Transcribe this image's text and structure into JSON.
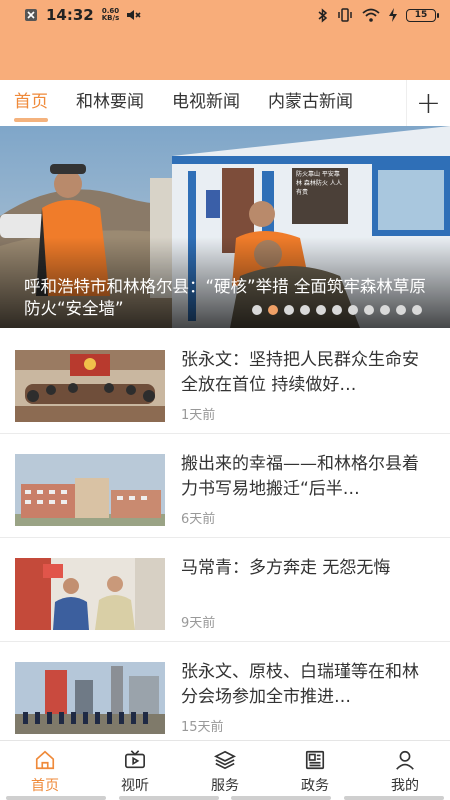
{
  "status_bar": {
    "time": "14:32",
    "net_speed_value": "0.60",
    "net_speed_unit": "KB/s",
    "battery": "15"
  },
  "tabs": [
    {
      "label": "首页",
      "active": true
    },
    {
      "label": "和林要闻",
      "active": false
    },
    {
      "label": "电视新闻",
      "active": false
    },
    {
      "label": "内蒙古新闻",
      "active": false
    }
  ],
  "add_tab_label": "+",
  "banner": {
    "caption": "呼和浩特市和林格尔县：“硬核”举措 全面筑牢森林草原防火“安全墙”",
    "sign_text": "防火靠山 平安靠林 森林防火 人人有责",
    "dot_count": 11,
    "active_dot": 1
  },
  "news": [
    {
      "title": "张永文：坚持把人民群众生命安全放在首位 持续做好…",
      "time": "1天前",
      "thumb": "meeting-room"
    },
    {
      "title": "搬出来的幸福——和林格尔县着力书写易地搬迁“后半…",
      "time": "6天前",
      "thumb": "apartment-buildings"
    },
    {
      "title": "马常青：多方奔走 无怨无悔",
      "time": "9天前",
      "thumb": "elderly-couple"
    },
    {
      "title": "张永文、原枝、白瑞瑾等在和林分会场参加全市推进…",
      "time": "15天前",
      "thumb": "industrial-site"
    }
  ],
  "bottom_nav": [
    {
      "label": "首页",
      "icon": "home-icon",
      "active": true
    },
    {
      "label": "视听",
      "icon": "tv-icon",
      "active": false
    },
    {
      "label": "服务",
      "icon": "layers-icon",
      "active": false
    },
    {
      "label": "政务",
      "icon": "newspaper-icon",
      "active": false
    },
    {
      "label": "我的",
      "icon": "user-icon",
      "active": false
    }
  ],
  "colors": {
    "header": "#f8ad7a",
    "accent": "#ef8a3a",
    "active_dot": "#f0a066"
  }
}
